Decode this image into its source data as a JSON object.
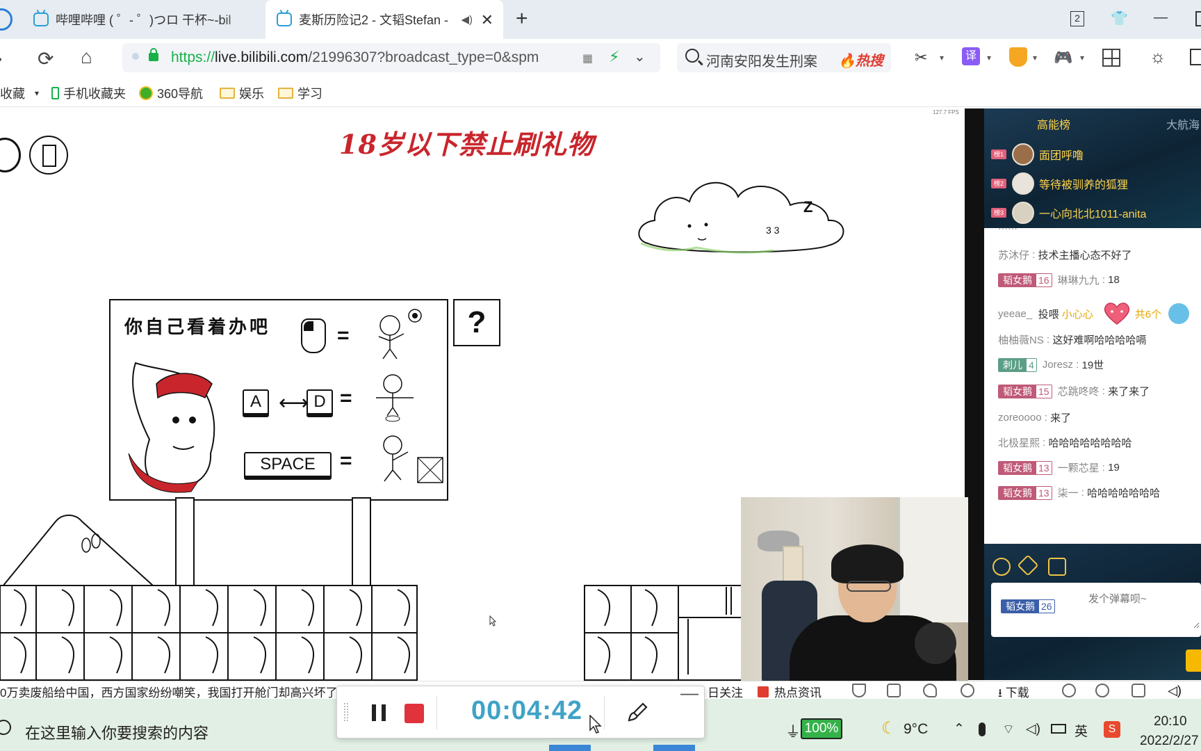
{
  "tabs": [
    {
      "title": "哔哩哔哩 ( ゜- ゜)つロ 干杯~-bil"
    },
    {
      "title": "麦斯历险记2 - 文韬Stefan -"
    }
  ],
  "window": {
    "tab_count": "2"
  },
  "address_bar": {
    "protocol": "https://",
    "host": "live.bilibili.com",
    "path": "/21996307?broadcast_type=0&spm"
  },
  "search_box": {
    "placeholder": "河南安阳发生刑案",
    "hot_label": "🔥热搜"
  },
  "toolbar": {
    "translate_label": "译"
  },
  "bookmarks": [
    {
      "label": "收藏",
      "icon": "star-icon"
    },
    {
      "label": "手机收藏夹",
      "icon": "phone-icon"
    },
    {
      "label": "360导航",
      "icon": "nav360-icon"
    },
    {
      "label": "娱乐",
      "icon": "folder-icon"
    },
    {
      "label": "学习",
      "icon": "folder-icon"
    }
  ],
  "game": {
    "fps": "127.7 FPS",
    "banner": "18岁以下禁止刷礼物",
    "board_title": "你自己看着办吧",
    "keys": {
      "a": "A",
      "d": "D",
      "space": "SPACE"
    },
    "question_mark": "?",
    "cloud_text": "3 3",
    "zzz": "Z"
  },
  "chat": {
    "rank_tabs": [
      "高能榜",
      "大航海"
    ],
    "rank": [
      {
        "badge": "榜1",
        "name": "面团呼噜"
      },
      {
        "badge": "榜2",
        "name": "等待被驯养的狐狸"
      },
      {
        "badge": "榜3",
        "name": "一心向北北1011-anita"
      }
    ],
    "messages": [
      {
        "user": "苏沐仔",
        "text": "技术主播心态不好了"
      },
      {
        "medal": "韬女鹅",
        "level": "16",
        "user": "琳琳九九",
        "text": "18"
      },
      {
        "user": "yeeae_",
        "action": "投喂",
        "gift": "小心心",
        "count": "共6个"
      },
      {
        "user": "柚柚薇NS",
        "text": "这好难啊哈哈哈哈嗝"
      },
      {
        "medal": "刺儿",
        "level": "4",
        "user": "Joresz",
        "text": "19世"
      },
      {
        "medal": "韬女鹅",
        "level": "15",
        "user": "芯跳咚咚",
        "text": "来了来了"
      },
      {
        "user": "zoreoooo",
        "text": "来了"
      },
      {
        "user": "北极星熙",
        "text": "哈哈哈哈哈哈哈哈"
      },
      {
        "medal": "韬女鹅",
        "level": "13",
        "user": "一颗芯星",
        "text": "19"
      },
      {
        "medal": "韬女鹅",
        "level": "13",
        "user": "柒一",
        "text": "哈哈哈哈哈哈哈"
      }
    ],
    "input_placeholder": "发个弹幕呗~",
    "input_medal": "韬女鹅",
    "input_medal_level": "26"
  },
  "news": {
    "headline": "0万卖废船给中国，西方国家纷纷嘲笑，我国打开舱门却高兴坏了",
    "follow": "日关注",
    "hot": "热点资讯",
    "download": "下载"
  },
  "recorder": {
    "elapsed": "00:04:42"
  },
  "taskbar": {
    "search_placeholder": "在这里输入你要搜索的内容",
    "battery": "100%",
    "temperature": "9°C",
    "ime": "英",
    "time": "20:10",
    "date": "2022/2/27"
  },
  "colors": {
    "accent": "#2a9fd6",
    "secure": "#19b04a",
    "banner": "#c8262c",
    "timer": "#3fa3c6",
    "rank_gold": "#ffd34a",
    "medal": "#bf5a78"
  }
}
